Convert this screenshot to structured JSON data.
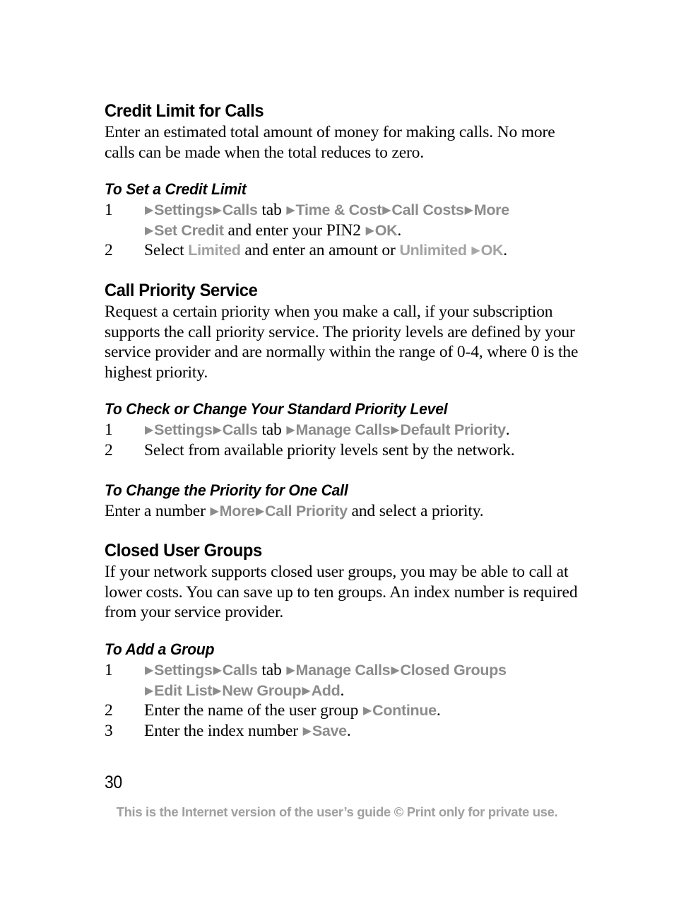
{
  "document": {
    "page_number": "30",
    "footer_note": "This is the Internet version of the user’s guide © Print only for private use.",
    "colors": {
      "text": "#000000",
      "ui_token": "#8c8c8c",
      "ui_token_light": "#a3a3a3",
      "footer": "#a0a0a0",
      "background": "#ffffff"
    },
    "arrow_glyph": "▶"
  },
  "sections": {
    "credit_limit": {
      "heading": "Credit Limit for Calls",
      "body": "Enter an estimated total amount of money for making calls. No more calls can be made when the total reduces to zero.",
      "task_heading": "To Set a Credit Limit",
      "steps": {
        "one": {
          "num": "1",
          "t1": "Settings",
          "t2": "Calls",
          "t3": "tab",
          "t4": "Time & Cost",
          "t5": "Call Costs",
          "t6": "More",
          "c1": "Set Credit",
          "c2": "and enter your PIN2",
          "c3": "OK",
          "c4": "."
        },
        "two": {
          "num": "2",
          "t1": "Select",
          "t2": "Limited",
          "t3": "and enter an amount or",
          "t4": "Unlimited",
          "t5": "OK",
          "t6": "."
        }
      }
    },
    "call_priority": {
      "heading": "Call Priority Service",
      "body": "Request a certain priority when you make a call, if your subscription supports the call priority service. The priority levels are defined by your service provider and are normally within the range of 0-4, where 0 is the highest priority.",
      "task_heading": "To Check or Change Your Standard Priority Level",
      "steps": {
        "one": {
          "num": "1",
          "t1": "Settings",
          "t2": "Calls",
          "t3": "tab",
          "t4": "Manage Calls",
          "t5": "Default Priority",
          "t6": "."
        },
        "two": {
          "num": "2",
          "text": "Select from available priority levels sent by the network."
        }
      }
    },
    "change_priority_one_call": {
      "task_heading": "To Change the Priority for One Call",
      "line": {
        "t1": "Enter a number",
        "t2": "More",
        "t3": "Call Priority",
        "t4": "and select a priority."
      }
    },
    "closed_user_groups": {
      "heading": "Closed User Groups",
      "body": "If your network supports closed user groups, you may be able to call at lower costs. You can save up to ten groups. An index number is required from your service provider.",
      "task_heading": "To Add a Group",
      "steps": {
        "one": {
          "num": "1",
          "t1": "Settings",
          "t2": "Calls",
          "t3": "tab",
          "t4": "Manage Calls",
          "t5": "Closed Groups",
          "c1": "Edit List",
          "c2": "New Group",
          "c3": "Add",
          "c4": "."
        },
        "two": {
          "num": "2",
          "t1": "Enter the name of the user group",
          "t2": "Continue",
          "t3": "."
        },
        "three": {
          "num": "3",
          "t1": "Enter the index number",
          "t2": "Save",
          "t3": "."
        }
      }
    }
  }
}
